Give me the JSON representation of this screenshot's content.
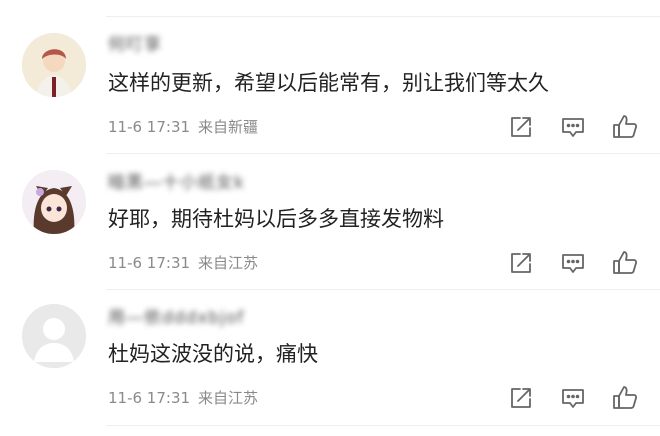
{
  "comments": [
    {
      "username": "何叮享",
      "text": "这样的更新，希望以后能常有，别让我们等太久",
      "date": "11-6 17:31",
      "location": "来自新疆"
    },
    {
      "username": "暗黑―十小纸女k",
      "text": "好耶，期待杜妈以后多多直接发物料",
      "date": "11-6 17:31",
      "location": "来自江苏"
    },
    {
      "username": "用―依dddxbjof",
      "text": "杜妈这波没的说，痛快",
      "date": "11-6 17:31",
      "location": "来自江苏"
    }
  ],
  "icons": {
    "share": "share-icon",
    "reply": "comment-icon",
    "like": "thumbs-up-icon"
  },
  "colors": {
    "text": "#222222",
    "meta": "#8a8a8a",
    "icon": "#666666",
    "divider": "#eeeeee"
  }
}
